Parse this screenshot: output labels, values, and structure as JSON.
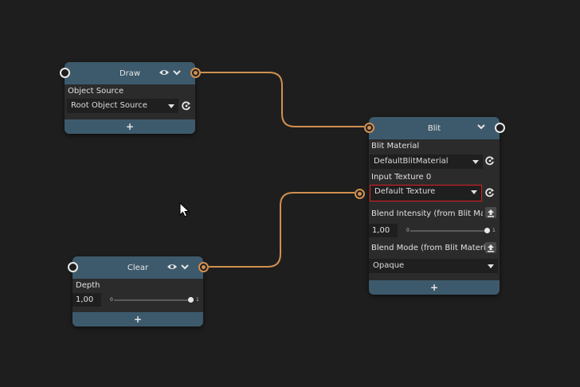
{
  "nodes": {
    "draw": {
      "title": "Draw",
      "object_source_label": "Object Source",
      "object_source_value": "Root Object Source",
      "add_label": "+"
    },
    "blit": {
      "title": "Blit",
      "blit_material_label": "Blit Material",
      "blit_material_value": "DefaultBlitMaterial",
      "input_texture_label": "Input Texture 0",
      "input_texture_value": "Default Texture",
      "blend_intensity_label": "Blend Intensity (from Blit Materia",
      "blend_intensity_value": "1,00",
      "blend_intensity_min": "0",
      "blend_intensity_max": "1",
      "blend_intensity_level": 1.0,
      "blend_mode_label": "Blend Mode (from Blit Material)",
      "blend_mode_value": "Opaque",
      "add_label": "+"
    },
    "clear": {
      "title": "Clear",
      "depth_label": "Depth",
      "depth_value": "1,00",
      "depth_min": "0",
      "depth_max": "1",
      "depth_level": 1.0,
      "add_label": "+"
    }
  },
  "colors": {
    "background": "#1e1e1e",
    "node_header": "#3d5a6c",
    "node_body": "#2b2b2b",
    "wire": "#d09050",
    "highlight_border": "#e01e1e"
  },
  "icons": {
    "visibility": "eye-icon",
    "collapse": "chevron-down-icon",
    "reset": "reset-icon",
    "upload": "upload-icon",
    "cursor": "mouse-cursor-icon"
  }
}
